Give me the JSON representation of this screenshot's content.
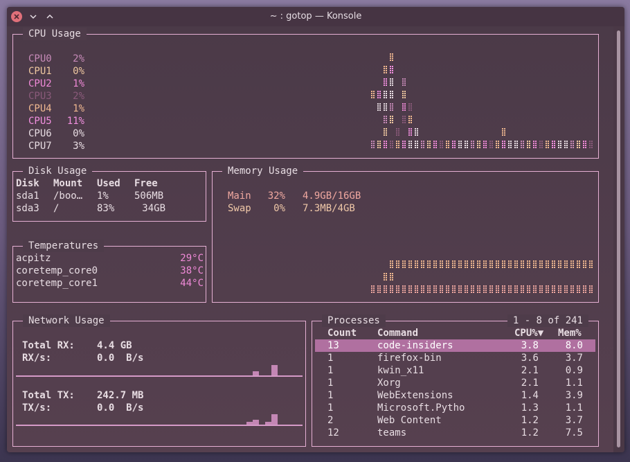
{
  "window": {
    "title": "~ : gotop — Konsole"
  },
  "cpu": {
    "title": "CPU Usage",
    "cores": [
      {
        "name": "CPU0",
        "value": "2%"
      },
      {
        "name": "CPU1",
        "value": "0%"
      },
      {
        "name": "CPU2",
        "value": "1%"
      },
      {
        "name": "CPU3",
        "value": "2%"
      },
      {
        "name": "CPU4",
        "value": "1%"
      },
      {
        "name": "CPU5",
        "value": "11%"
      },
      {
        "name": "CPU6",
        "value": "0%"
      },
      {
        "name": "CPU7",
        "value": "3%"
      }
    ],
    "colors": [
      "#c78ab8",
      "#efc8a0",
      "#f08ad8",
      "#8a5a7a",
      "#f0b890",
      "#f290e0",
      "#e8dde3",
      "#e8dde3"
    ]
  },
  "disk": {
    "title": "Disk Usage",
    "headers": [
      "Disk",
      "Mount",
      "Used",
      "Free"
    ],
    "rows": [
      [
        "sda1",
        "/boo…",
        "1%",
        "506MB"
      ],
      [
        "sda3",
        "/",
        "83%",
        "34GB"
      ]
    ]
  },
  "temps": {
    "title": "Temperatures",
    "rows": [
      {
        "name": "acpitz",
        "value": "29°C"
      },
      {
        "name": "coretemp_core0",
        "value": "38°C"
      },
      {
        "name": "coretemp_core1",
        "value": "44°C"
      }
    ]
  },
  "memory": {
    "title": "Memory Usage",
    "main": {
      "label": "Main",
      "pct": "32%",
      "amount": "4.9GB/16GB"
    },
    "swap": {
      "label": "Swap",
      "pct": "0%",
      "amount": "7.3MB/4GB"
    }
  },
  "network": {
    "title": "Network Usage",
    "rx_total_label": "Total RX:",
    "rx_total": "4.4 GB",
    "rx_rate_label": "RX/s:",
    "rx_rate": "0.0  B/s",
    "tx_total_label": "Total TX:",
    "tx_total": "242.7 MB",
    "tx_rate_label": "TX/s:",
    "tx_rate": "0.0  B/s"
  },
  "processes": {
    "title": "Processes",
    "range": "1 - 8 of 241",
    "headers": [
      "Count",
      "Command",
      "CPU%▼",
      "Mem%"
    ],
    "rows": [
      [
        "13",
        "code-insiders",
        "3.8",
        "8.0"
      ],
      [
        "1",
        "firefox-bin",
        "3.6",
        "3.7"
      ],
      [
        "1",
        "kwin_x11",
        "2.1",
        "0.9"
      ],
      [
        "1",
        "Xorg",
        "2.1",
        "1.1"
      ],
      [
        "1",
        "WebExtensions",
        "1.4",
        "3.9"
      ],
      [
        "1",
        "Microsoft.Pytho",
        "1.3",
        "1.1"
      ],
      [
        "2",
        "Web Content",
        "1.2",
        "3.7"
      ],
      [
        "12",
        "teams",
        "1.2",
        "7.5"
      ]
    ],
    "selected_row": 0
  }
}
